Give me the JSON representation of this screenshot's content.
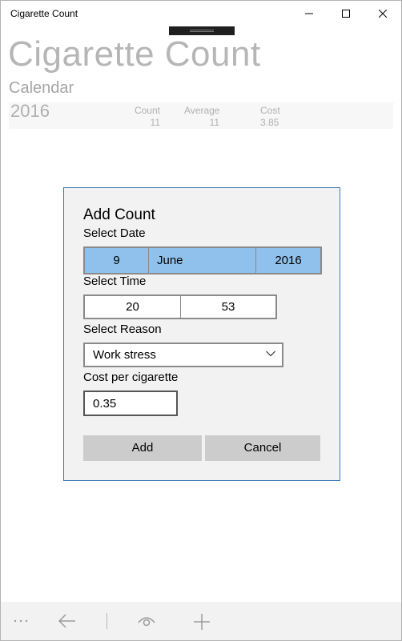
{
  "window": {
    "title": "Cigarette Count"
  },
  "header": {
    "app_title": "Cigarette Count",
    "section": "Calendar"
  },
  "summary": {
    "year": "2016",
    "count_label": "Count",
    "count_value": "11",
    "average_label": "Average",
    "average_value": "11",
    "cost_label": "Cost",
    "cost_value": "3.85"
  },
  "dialog": {
    "title": "Add Count",
    "date_label": "Select Date",
    "date_day": "9",
    "date_month": "June",
    "date_year": "2016",
    "time_label": "Select Time",
    "time_hour": "20",
    "time_minute": "53",
    "reason_label": "Select Reason",
    "reason_value": "Work stress",
    "cost_label": "Cost per cigarette",
    "cost_value": "0.35",
    "add_label": "Add",
    "cancel_label": "Cancel"
  },
  "appbar": {
    "icons": [
      "more-icon",
      "back-icon",
      "view-icon",
      "add-icon"
    ]
  },
  "colors": {
    "selection": "#8fc1ec",
    "dialog_border": "#3a78b8",
    "button": "#cccccc"
  }
}
